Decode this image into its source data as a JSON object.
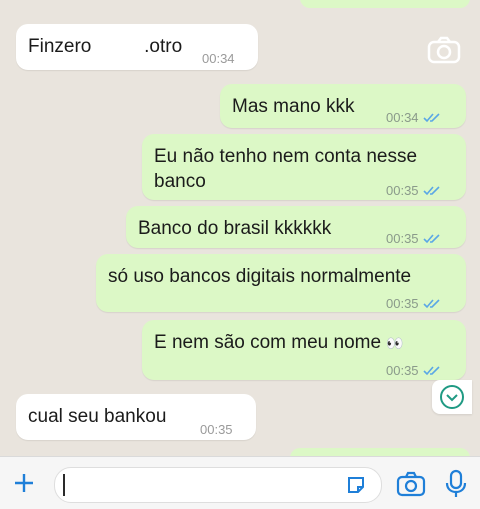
{
  "messages": [
    {
      "id": "m1",
      "direction": "in",
      "text": "Finzero          .otro",
      "time": "00:34"
    },
    {
      "id": "m2",
      "direction": "out",
      "text": "Mas mano kkk",
      "time": "00:34",
      "status": "read"
    },
    {
      "id": "m3",
      "direction": "out",
      "text": "Eu não tenho nem conta nesse banco",
      "time": "00:35",
      "status": "read"
    },
    {
      "id": "m4",
      "direction": "out",
      "text": "Banco do brasil kkkkkk",
      "time": "00:35",
      "status": "read"
    },
    {
      "id": "m5",
      "direction": "out",
      "text": "só uso bancos digitais normalmente",
      "time": "00:35",
      "status": "read"
    },
    {
      "id": "m6",
      "direction": "out",
      "text": "E nem são com meu nome",
      "emoji": "👀",
      "time": "00:35",
      "status": "read"
    },
    {
      "id": "m7",
      "direction": "in",
      "text": "cual seu bankou",
      "time": "00:35"
    }
  ],
  "input": {
    "value": ""
  },
  "icons": {
    "add": "plus-icon",
    "sticker": "sticker-icon",
    "camera": "camera-icon",
    "mic": "microphone-icon",
    "scroll": "chevron-down-icon",
    "read": "double-check-icon"
  },
  "colors": {
    "outgoing_bubble": "#dcf8c6",
    "incoming_bubble": "#ffffff",
    "read_ticks": "#5aa7e6",
    "accent": "#1f9a83"
  }
}
